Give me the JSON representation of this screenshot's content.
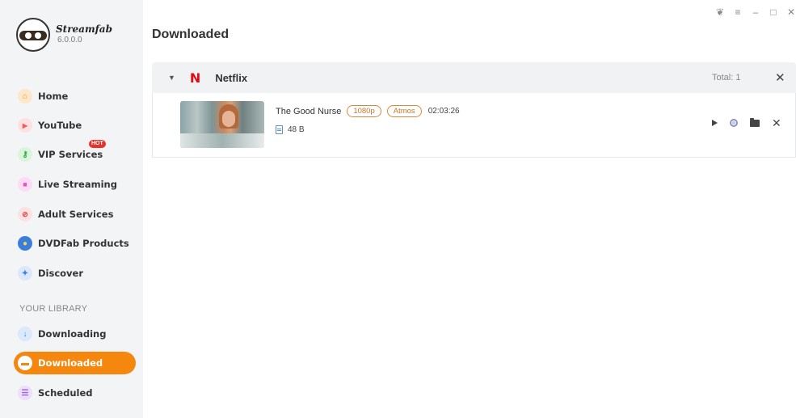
{
  "app": {
    "name": "Streamfab",
    "version": "6.0.0.0"
  },
  "window_controls": [
    "❦",
    "≡",
    "–",
    "□",
    "✕"
  ],
  "sidebar": {
    "items": [
      {
        "label": "Home",
        "icon": "home-icon",
        "color": "#f7a541"
      },
      {
        "label": "YouTube",
        "icon": "youtube-icon",
        "color": "#f25b5b"
      },
      {
        "label": "VIP Services",
        "icon": "key-icon",
        "color": "#3fbf4a",
        "badge": "HOT"
      },
      {
        "label": "Live Streaming",
        "icon": "live-icon",
        "color": "#e94fc7"
      },
      {
        "label": "Adult Services",
        "icon": "adult-icon",
        "color": "#e84040"
      },
      {
        "label": "DVDFab Products",
        "icon": "dvdfab-icon",
        "color": "#3b7ddd"
      },
      {
        "label": "Discover",
        "icon": "compass-icon",
        "color": "#3f7fe0"
      }
    ],
    "library_label": "YOUR LIBRARY",
    "library_items": [
      {
        "label": "Downloading",
        "icon": "download-icon",
        "color": "#3b8ee8"
      },
      {
        "label": "Downloaded",
        "icon": "folder-icon",
        "color": "#f5870f",
        "active": true
      },
      {
        "label": "Scheduled",
        "icon": "scheduled-icon",
        "color": "#9b5fe0"
      }
    ]
  },
  "main": {
    "title": "Downloaded",
    "group": {
      "logo": "N",
      "name": "Netflix",
      "total": "Total: 1",
      "items": [
        {
          "title": "The Good Nurse",
          "badges": [
            "1080p",
            "Atmos"
          ],
          "duration": "02:03:26",
          "size": "48 B"
        }
      ]
    }
  },
  "colors": {
    "accent": "#f5870f",
    "netflix": "#e50914",
    "hot": "#e8322b"
  }
}
